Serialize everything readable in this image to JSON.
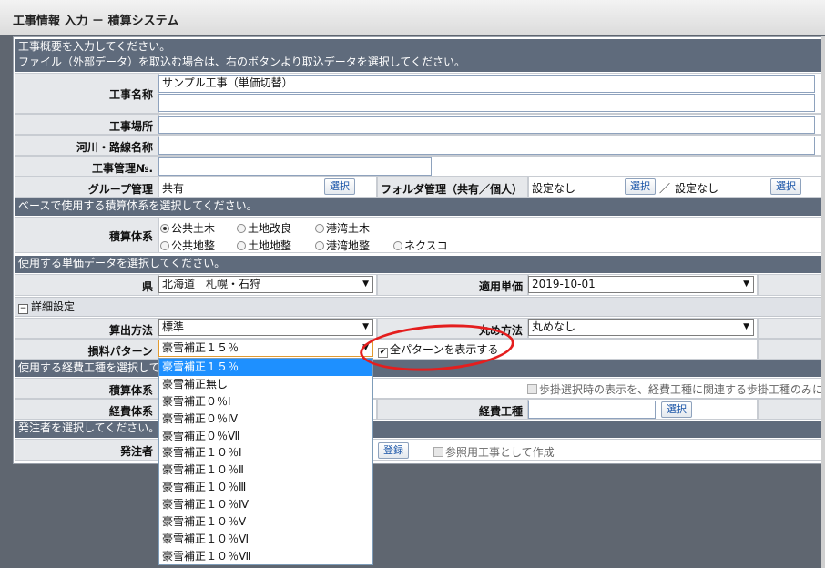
{
  "window": {
    "title": "工事情報 入力 － 積算システム"
  },
  "header": {
    "line1": "工事概要を入力してください。",
    "line2": "ファイル（外部データ）を取込む場合は、右のボタンより取込データを選択してください。"
  },
  "labels": {
    "koji_name": "工事名称",
    "koji_place": "工事場所",
    "river": "河川・路線名称",
    "koji_no": "工事管理№.",
    "group": "グループ管理",
    "folder": "フォルダ管理（共有／個人）",
    "sekisan_taikei": "積算体系",
    "ken": "県",
    "tekiyo_tanka": "適用単価",
    "santei": "算出方法",
    "marume": "丸め方法",
    "sonryo": "損料パターン",
    "sekisan_taikei2": "積算体系",
    "keihi_taikei": "経費体系",
    "keihi_koshu": "経費工種",
    "hacchusha": "発注者"
  },
  "fields": {
    "koji_name_value": "サンプル工事（単価切替）",
    "group_value": "共有",
    "folder_value1": "設定なし",
    "folder_sep": "／",
    "folder_value2": "設定なし",
    "select_label": "選択",
    "register_label": "登録"
  },
  "sections": {
    "base": "ベースで使用する積算体系を選択してください。",
    "tanka": "使用する単価データを選択してください。",
    "detail": "詳細設定",
    "keihi": "使用する経費工種を選択して",
    "hacchu": "発注者を選択してください。"
  },
  "radios": {
    "r1": "公共土木",
    "r2": "土地改良",
    "r3": "港湾土木",
    "r4": "公共地整",
    "r5": "土地地整",
    "r6": "港湾地整",
    "r7": "ネクスコ"
  },
  "selects": {
    "ken": "北海道　札幌・石狩",
    "tekiyo": "2019-10-01",
    "santei": "標準",
    "marume": "丸めなし",
    "sonryo": "豪雪補正１５％"
  },
  "checkboxes": {
    "all_pattern": "全パターンを表示する",
    "hokake": "歩掛選択時の表示を、経費工種に関連する歩掛工種のみに",
    "reference": "参照用工事として作成"
  },
  "dropdown_options": [
    "豪雪補正１５％",
    "豪雪補正無し",
    "豪雪補正０％Ⅰ",
    "豪雪補正０％Ⅳ",
    "豪雪補正０％Ⅶ",
    "豪雪補正１０％Ⅰ",
    "豪雪補正１０％Ⅱ",
    "豪雪補正１０％Ⅲ",
    "豪雪補正１０％Ⅳ",
    "豪雪補正１０％Ⅴ",
    "豪雪補正１０％Ⅵ",
    "豪雪補正１０％Ⅶ"
  ],
  "colors": {
    "highlight": "#e41e1e",
    "selected_option": "#1e90ff",
    "section_bar": "#5f6b7c"
  }
}
